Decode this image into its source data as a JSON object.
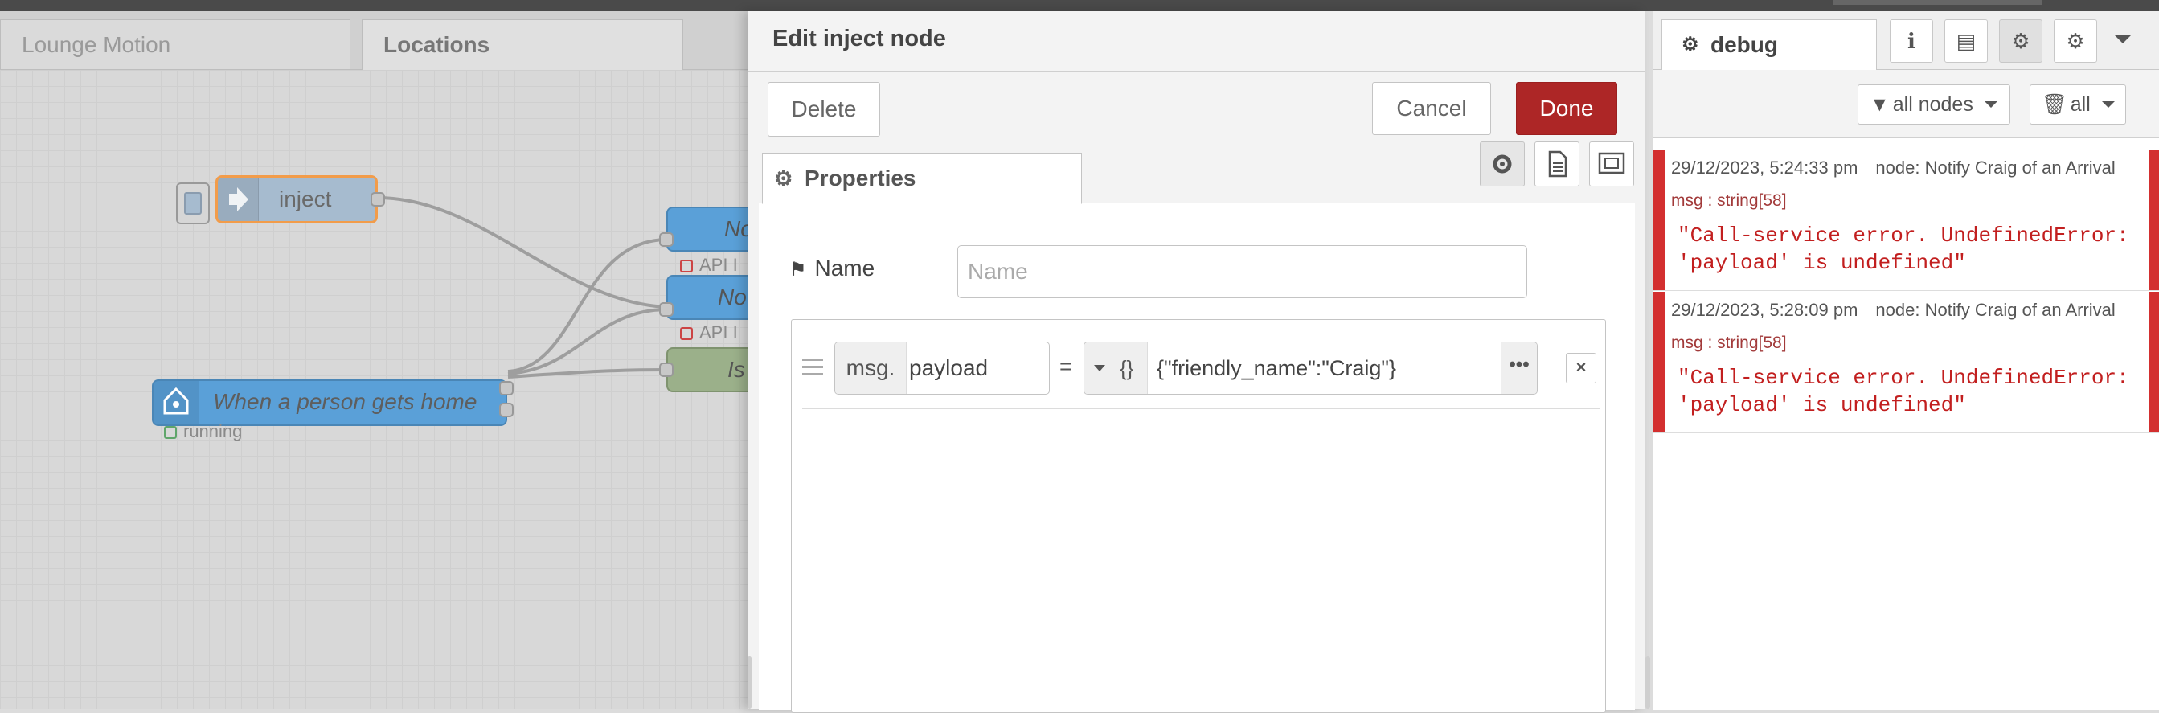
{
  "workspace": {
    "tabs": [
      {
        "label": "Lounge Motion"
      },
      {
        "label": "Locations"
      }
    ],
    "nodes": {
      "inject": {
        "label": "inject"
      },
      "trigger": {
        "label": "When a person gets home",
        "status": "running"
      },
      "partial": [
        {
          "label": "No"
        },
        {
          "label": "No"
        },
        {
          "label": "Is"
        }
      ],
      "status_labels": [
        "API I",
        "API I"
      ]
    }
  },
  "dialog": {
    "title": "Edit inject node",
    "delete_label": "Delete",
    "cancel_label": "Cancel",
    "done_label": "Done",
    "properties_tab": "Properties",
    "name_label": "Name",
    "name_placeholder": "Name",
    "name_value": "",
    "rule": {
      "prefix": "msg.",
      "property": "payload",
      "equals": "=",
      "type_glyph": "{}",
      "value": "{\"friendly_name\":\"Craig\"}",
      "ellipsis": "•••",
      "remove": "×"
    }
  },
  "sidebar": {
    "tab_label": "debug",
    "filter_nodes": "all nodes",
    "filter_clear": "all",
    "messages": [
      {
        "timestamp": "29/12/2023, 5:24:33 pm",
        "node": "node: Notify Craig of an Arrival",
        "type": "msg : string[58]",
        "line1": "\"Call-service error. UndefinedError:",
        "line2": "'payload' is undefined\""
      },
      {
        "timestamp": "29/12/2023, 5:28:09 pm",
        "node": "node: Notify Craig of an Arrival",
        "type": "msg : string[58]",
        "line1": "\"Call-service error. UndefinedError:",
        "line2": "'payload' is undefined\""
      }
    ]
  },
  "colors": {
    "done_button": "#ad2626",
    "error_bar": "#d32f2f",
    "error_text": "#c21f1f",
    "inject_node": "#a6bbcf",
    "trigger_node": "#5aa0d8",
    "api_node": "#9bb08a"
  }
}
